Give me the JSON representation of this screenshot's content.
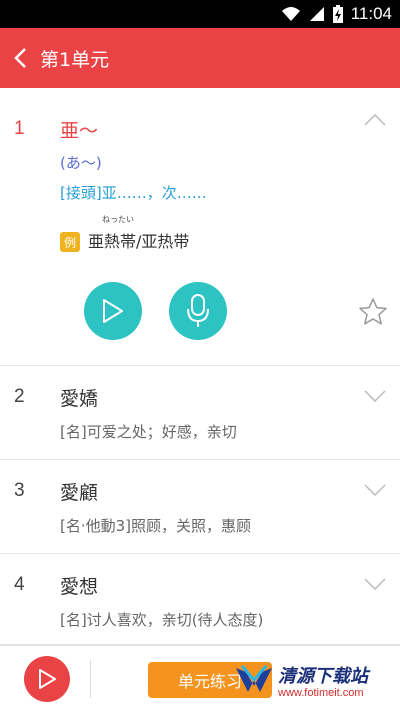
{
  "status_bar": {
    "time": "11:04",
    "icons": [
      "wifi-icon",
      "signal-icon",
      "battery-icon"
    ]
  },
  "header": {
    "title": "第1单元",
    "background": "#e94346"
  },
  "entries": [
    {
      "number": "1",
      "word": "亜～",
      "reading": "(あ～)",
      "prefix_meaning": "[接頭]亚……，次……",
      "example": {
        "badge": "例",
        "ruby": "ねったい",
        "text": "亜熱帯/亚热带"
      }
    },
    {
      "number": "2",
      "word": "愛嬌",
      "meaning": "[名]可爱之处；好感，亲切"
    },
    {
      "number": "3",
      "word": "愛顧",
      "meaning": "[名·他動3]照顾，关照，惠顾"
    },
    {
      "number": "4",
      "word": "愛想",
      "meaning": "[名]讨人喜欢，亲切(待人态度)"
    }
  ],
  "bottom_bar": {
    "practice_label": "单元练习",
    "watermark_title": "清源下载站",
    "watermark_url": "www.fotimeit.com"
  },
  "colors": {
    "accent": "#e94346",
    "teal": "#2ec3c3",
    "orange": "#f5931f",
    "example_badge": "#f0b21e"
  }
}
